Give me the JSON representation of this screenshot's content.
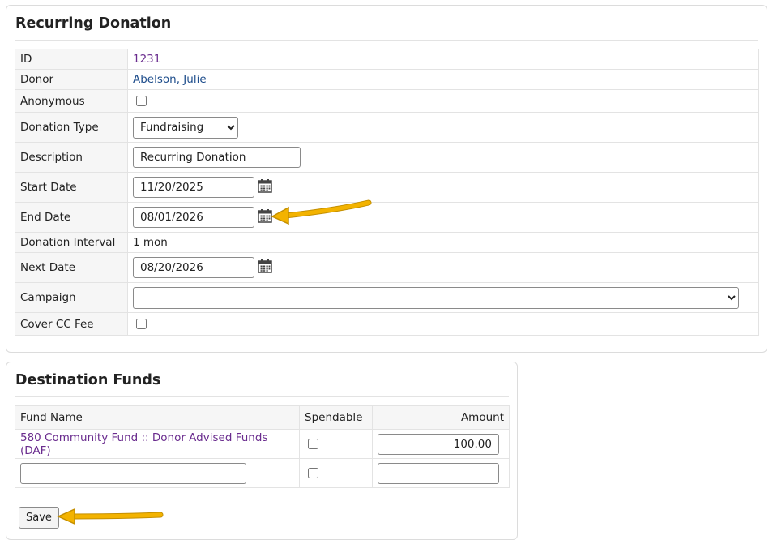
{
  "recurring": {
    "title": "Recurring Donation",
    "id_label": "ID",
    "id_value": "1231",
    "donor_label": "Donor",
    "donor_value": "Abelson, Julie",
    "anonymous_label": "Anonymous",
    "type_label": "Donation Type",
    "type_value": "Fundraising",
    "description_label": "Description",
    "description_value": "Recurring Donation",
    "start_label": "Start Date",
    "start_value": "11/20/2025",
    "end_label": "End Date",
    "end_value": "08/01/2026",
    "interval_label": "Donation Interval",
    "interval_value": "1 mon",
    "next_label": "Next Date",
    "next_value": "08/20/2026",
    "campaign_label": "Campaign",
    "campaign_value": "",
    "cover_label": "Cover CC Fee"
  },
  "funds": {
    "title": "Destination Funds",
    "columns": [
      "Fund Name",
      "Spendable",
      "Amount"
    ],
    "rows": [
      {
        "name": "580 Community Fund :: Donor Advised Funds (DAF)",
        "amount": "100.00"
      },
      {
        "name": "",
        "amount": ""
      }
    ],
    "save_label": "Save"
  },
  "colors": {
    "arrow": "#f3b300",
    "link": "#1f4e8c",
    "fund_link": "#6a2c8e"
  }
}
